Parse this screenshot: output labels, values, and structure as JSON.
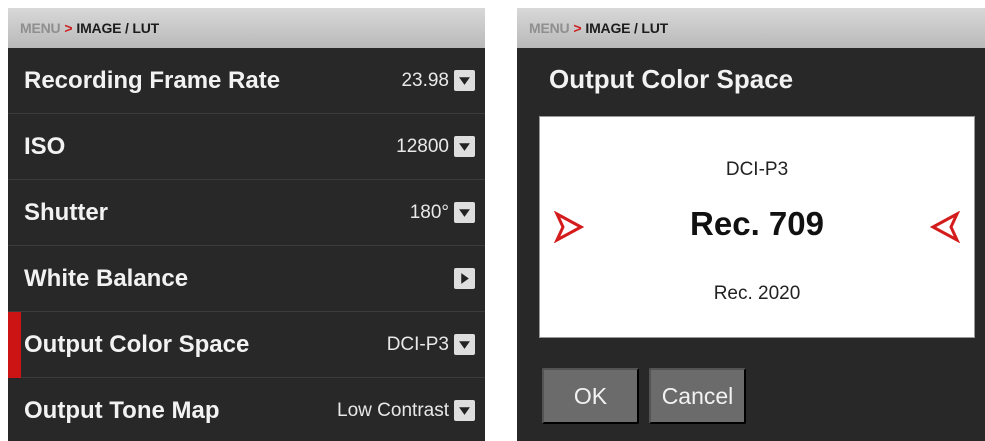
{
  "left": {
    "breadcrumb": {
      "root": "MENU",
      "current": "IMAGE / LUT"
    },
    "rows": [
      {
        "label": "Recording Frame Rate",
        "value": "23.98",
        "icon": "chevron-down-icon"
      },
      {
        "label": "ISO",
        "value": "12800",
        "icon": "chevron-down-icon"
      },
      {
        "label": "Shutter",
        "value": "180°",
        "icon": "chevron-down-icon"
      },
      {
        "label": "White Balance",
        "value": "",
        "icon": "chevron-right-icon"
      },
      {
        "label": "Output Color Space",
        "value": "DCI-P3",
        "icon": "chevron-down-icon",
        "selected": true
      },
      {
        "label": "Output Tone Map",
        "value": "Low Contrast",
        "icon": "chevron-down-icon"
      }
    ]
  },
  "right": {
    "breadcrumb": {
      "root": "MENU",
      "current": "IMAGE / LUT"
    },
    "title": "Output Color Space",
    "picker": {
      "previous": "DCI-P3",
      "selected": "Rec. 709",
      "next": "Rec. 2020"
    },
    "ok_label": "OK",
    "cancel_label": "Cancel"
  },
  "colors": {
    "accent": "#cc1414",
    "panel_bg": "#282828",
    "breadcrumb_bg": "#c8c8c8",
    "button_bg": "#6b6b6b"
  }
}
